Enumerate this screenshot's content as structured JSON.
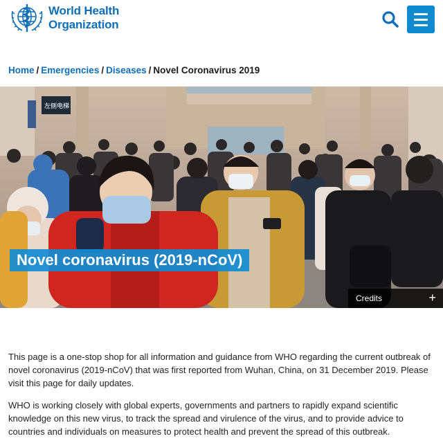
{
  "header": {
    "logo_line1": "World Health",
    "logo_line2": "Organization",
    "logo_icon": "who-emblem-icon",
    "search_icon": "search-icon",
    "menu_icon": "hamburger-menu-icon",
    "accent_color": "#0f6eb6"
  },
  "breadcrumb": {
    "items": [
      "Home",
      "Emergencies",
      "Diseases"
    ],
    "separator": "/",
    "current": "Novel Coronavirus 2019"
  },
  "hero": {
    "title": "Novel coronavirus (2019-nCoV)",
    "credits_label": "Credits",
    "credits_icon": "+",
    "image_description_icon": "crowd-photo",
    "sign_text": "左侧电梯"
  },
  "content": {
    "paragraphs": [
      "This page is a one-stop shop for all information and guidance from WHO regarding the current outbreak of novel coronavirus (2019-nCoV) that was first reported from Wuhan, China, on 31 December 2019. Please visit this page for daily updates.",
      "WHO is working closely with global experts, governments and partners to rapidly expand scientific knowledge on this new virus, to track the spread and virulence of the virus, and to provide advice to countries and individuals on measures to protect health and prevent the spread of this outbreak."
    ]
  }
}
